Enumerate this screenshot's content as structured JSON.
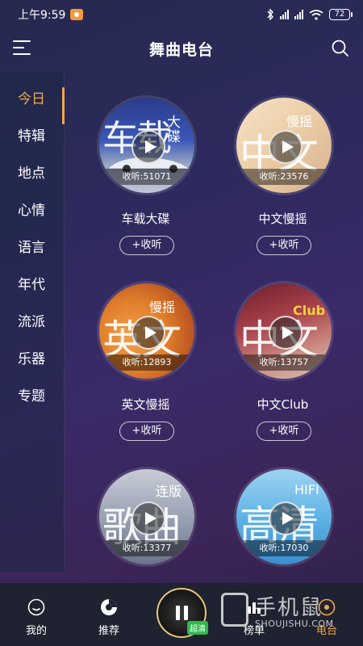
{
  "status": {
    "time": "上午9:59",
    "battery": "72"
  },
  "header": {
    "title": "舞曲电台"
  },
  "sidebar": {
    "items": [
      {
        "label": "今日",
        "active": true
      },
      {
        "label": "特辑"
      },
      {
        "label": "地点"
      },
      {
        "label": "心情"
      },
      {
        "label": "语言"
      },
      {
        "label": "年代"
      },
      {
        "label": "流派"
      },
      {
        "label": "乐器"
      },
      {
        "label": "专题"
      }
    ]
  },
  "stations": [
    {
      "title": "车载大碟",
      "plays": "收听:51071",
      "art_big": "车载",
      "art_small": "大碟",
      "subscribe": "+收听"
    },
    {
      "title": "中文慢摇",
      "plays": "收听:23576",
      "art_big": "中文",
      "art_small": "慢摇",
      "subscribe": "+收听"
    },
    {
      "title": "英文慢摇",
      "plays": "收听:12893",
      "art_big": "英文",
      "art_small": "慢摇",
      "subscribe": "+收听"
    },
    {
      "title": "中文Club",
      "plays": "收听:13757",
      "art_big": "中文",
      "art_small": "Club",
      "subscribe": "+收听"
    },
    {
      "title": "",
      "plays": "收听:13377",
      "art_big": "歌曲",
      "art_small": "连版",
      "subscribe": ""
    },
    {
      "title": "",
      "plays": "收听:17030",
      "art_big": "高清",
      "art_small": "HIFI",
      "subscribe": ""
    }
  ],
  "bottom_nav": {
    "items": [
      {
        "label": "我的",
        "icon": "smile-icon"
      },
      {
        "label": "推荐",
        "icon": "disc-icon"
      },
      {
        "label": "榜单",
        "icon": "chart-icon"
      },
      {
        "label": "电台",
        "icon": "radio-icon",
        "active": true
      }
    ],
    "player_badge": "超清"
  },
  "watermark": {
    "text": "手机鼠",
    "sub": "SHOUJISHU.COM"
  },
  "colors": {
    "accent": "#f0a84a",
    "nav_bg": "#1f2230"
  }
}
